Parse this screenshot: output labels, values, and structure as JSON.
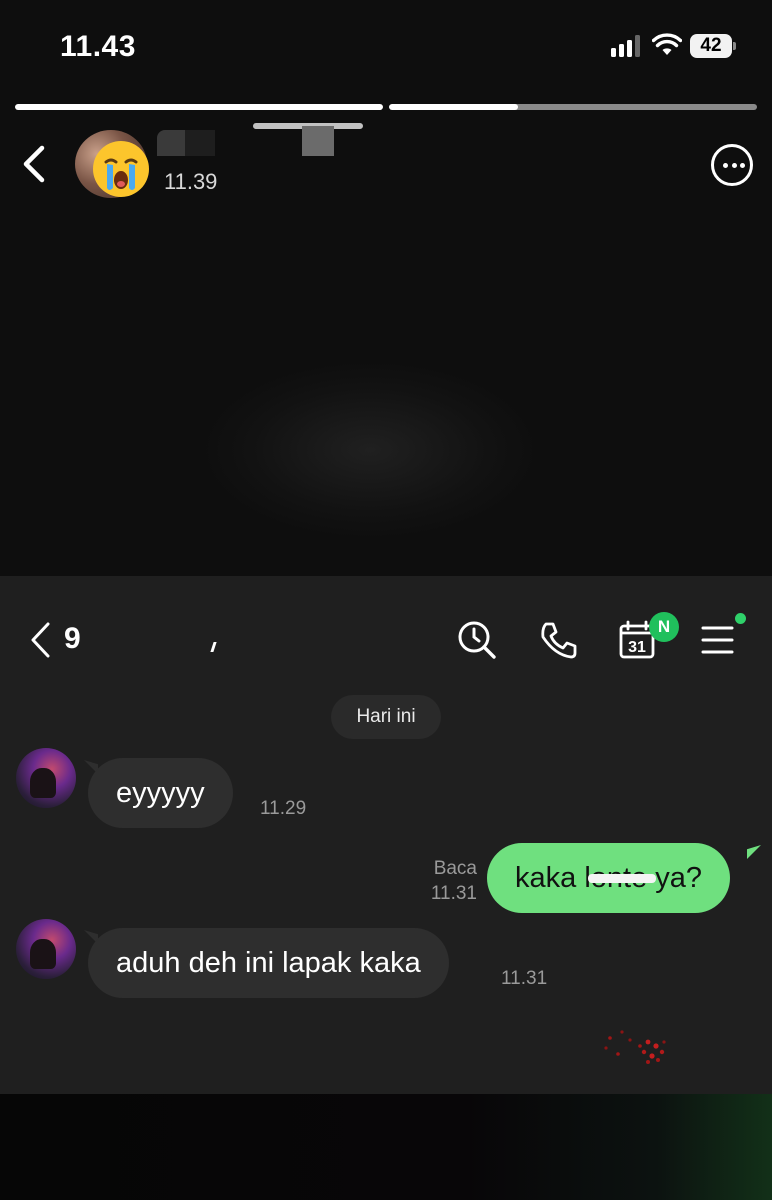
{
  "status_bar": {
    "time": "11.43",
    "battery_level": "42",
    "signal_bars": 4
  },
  "story": {
    "progress": [
      1.0,
      0.35
    ],
    "timestamp": "11.39",
    "avatar_emoji": "loudly-crying-face",
    "icons": {
      "back": "chevron-left-icon",
      "more": "ellipsis-circle-icon"
    }
  },
  "chat": {
    "header": {
      "unread_count": "9",
      "icons": [
        "back-chevron-icon",
        "search-clock-icon",
        "phone-icon",
        "calendar-icon",
        "menu-icon"
      ],
      "calendar_day": "31",
      "calendar_badge": "N"
    },
    "date_separator": "Hari ini",
    "messages": [
      {
        "direction": "incoming",
        "text": "eyyyyy",
        "time": "11.29"
      },
      {
        "direction": "outgoing",
        "text": "kaka lonte ya?",
        "status": "Baca",
        "time": "11.31"
      },
      {
        "direction": "incoming",
        "text": "aduh deh ini lapak kaka",
        "time": "11.31"
      }
    ]
  },
  "colors": {
    "outgoing_bubble": "#6fe07f",
    "incoming_bubble": "#2e2e2e",
    "chat_background": "#1f1f1f",
    "badge_green": "#20c05c"
  }
}
